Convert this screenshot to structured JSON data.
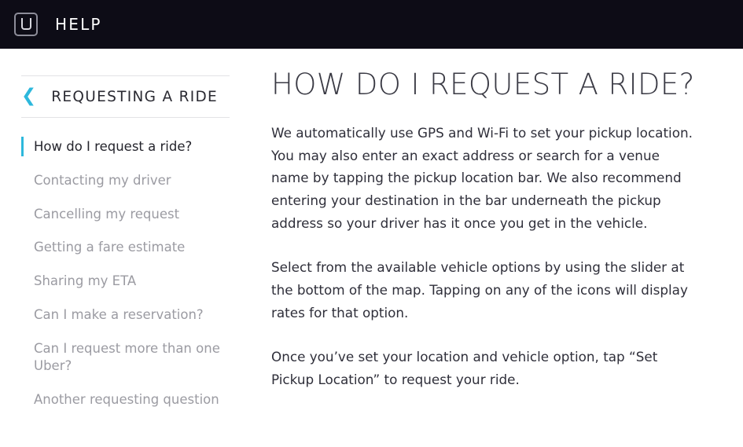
{
  "header": {
    "logo_icon": "uber-u-logo-icon",
    "title": "HELP"
  },
  "sidebar": {
    "back_icon": "chevron-left-icon",
    "category": "REQUESTING A RIDE",
    "items": [
      {
        "label": "How do I request a ride?",
        "active": true
      },
      {
        "label": "Contacting my driver",
        "active": false
      },
      {
        "label": "Cancelling my request",
        "active": false
      },
      {
        "label": "Getting a fare estimate",
        "active": false
      },
      {
        "label": "Sharing my ETA",
        "active": false
      },
      {
        "label": "Can I make a reservation?",
        "active": false
      },
      {
        "label": "Can I request more than one Uber?",
        "active": false
      },
      {
        "label": "Another requesting question",
        "active": false
      }
    ]
  },
  "main": {
    "title": "HOW DO I REQUEST A RIDE?",
    "paragraphs": [
      "We automatically use GPS and Wi-Fi to set your pickup location. You may also enter an exact address or search for a venue name by tapping the pickup location bar. We also recommend entering your destination in the bar underneath the pickup address so your driver has it once you get in the vehicle.",
      "Select from the available vehicle options by using the slider at the bottom of the map. Tapping on any of the icons will display rates for that option.",
      "Once you’ve set your location and vehicle option, tap “Set Pickup Location” to request your ride."
    ]
  },
  "colors": {
    "header_bg": "#0d0c16",
    "accent": "#2db8dc",
    "muted_text": "#9b9ba2",
    "body_text": "#2f2f3a",
    "rule": "#e3e3e5"
  }
}
